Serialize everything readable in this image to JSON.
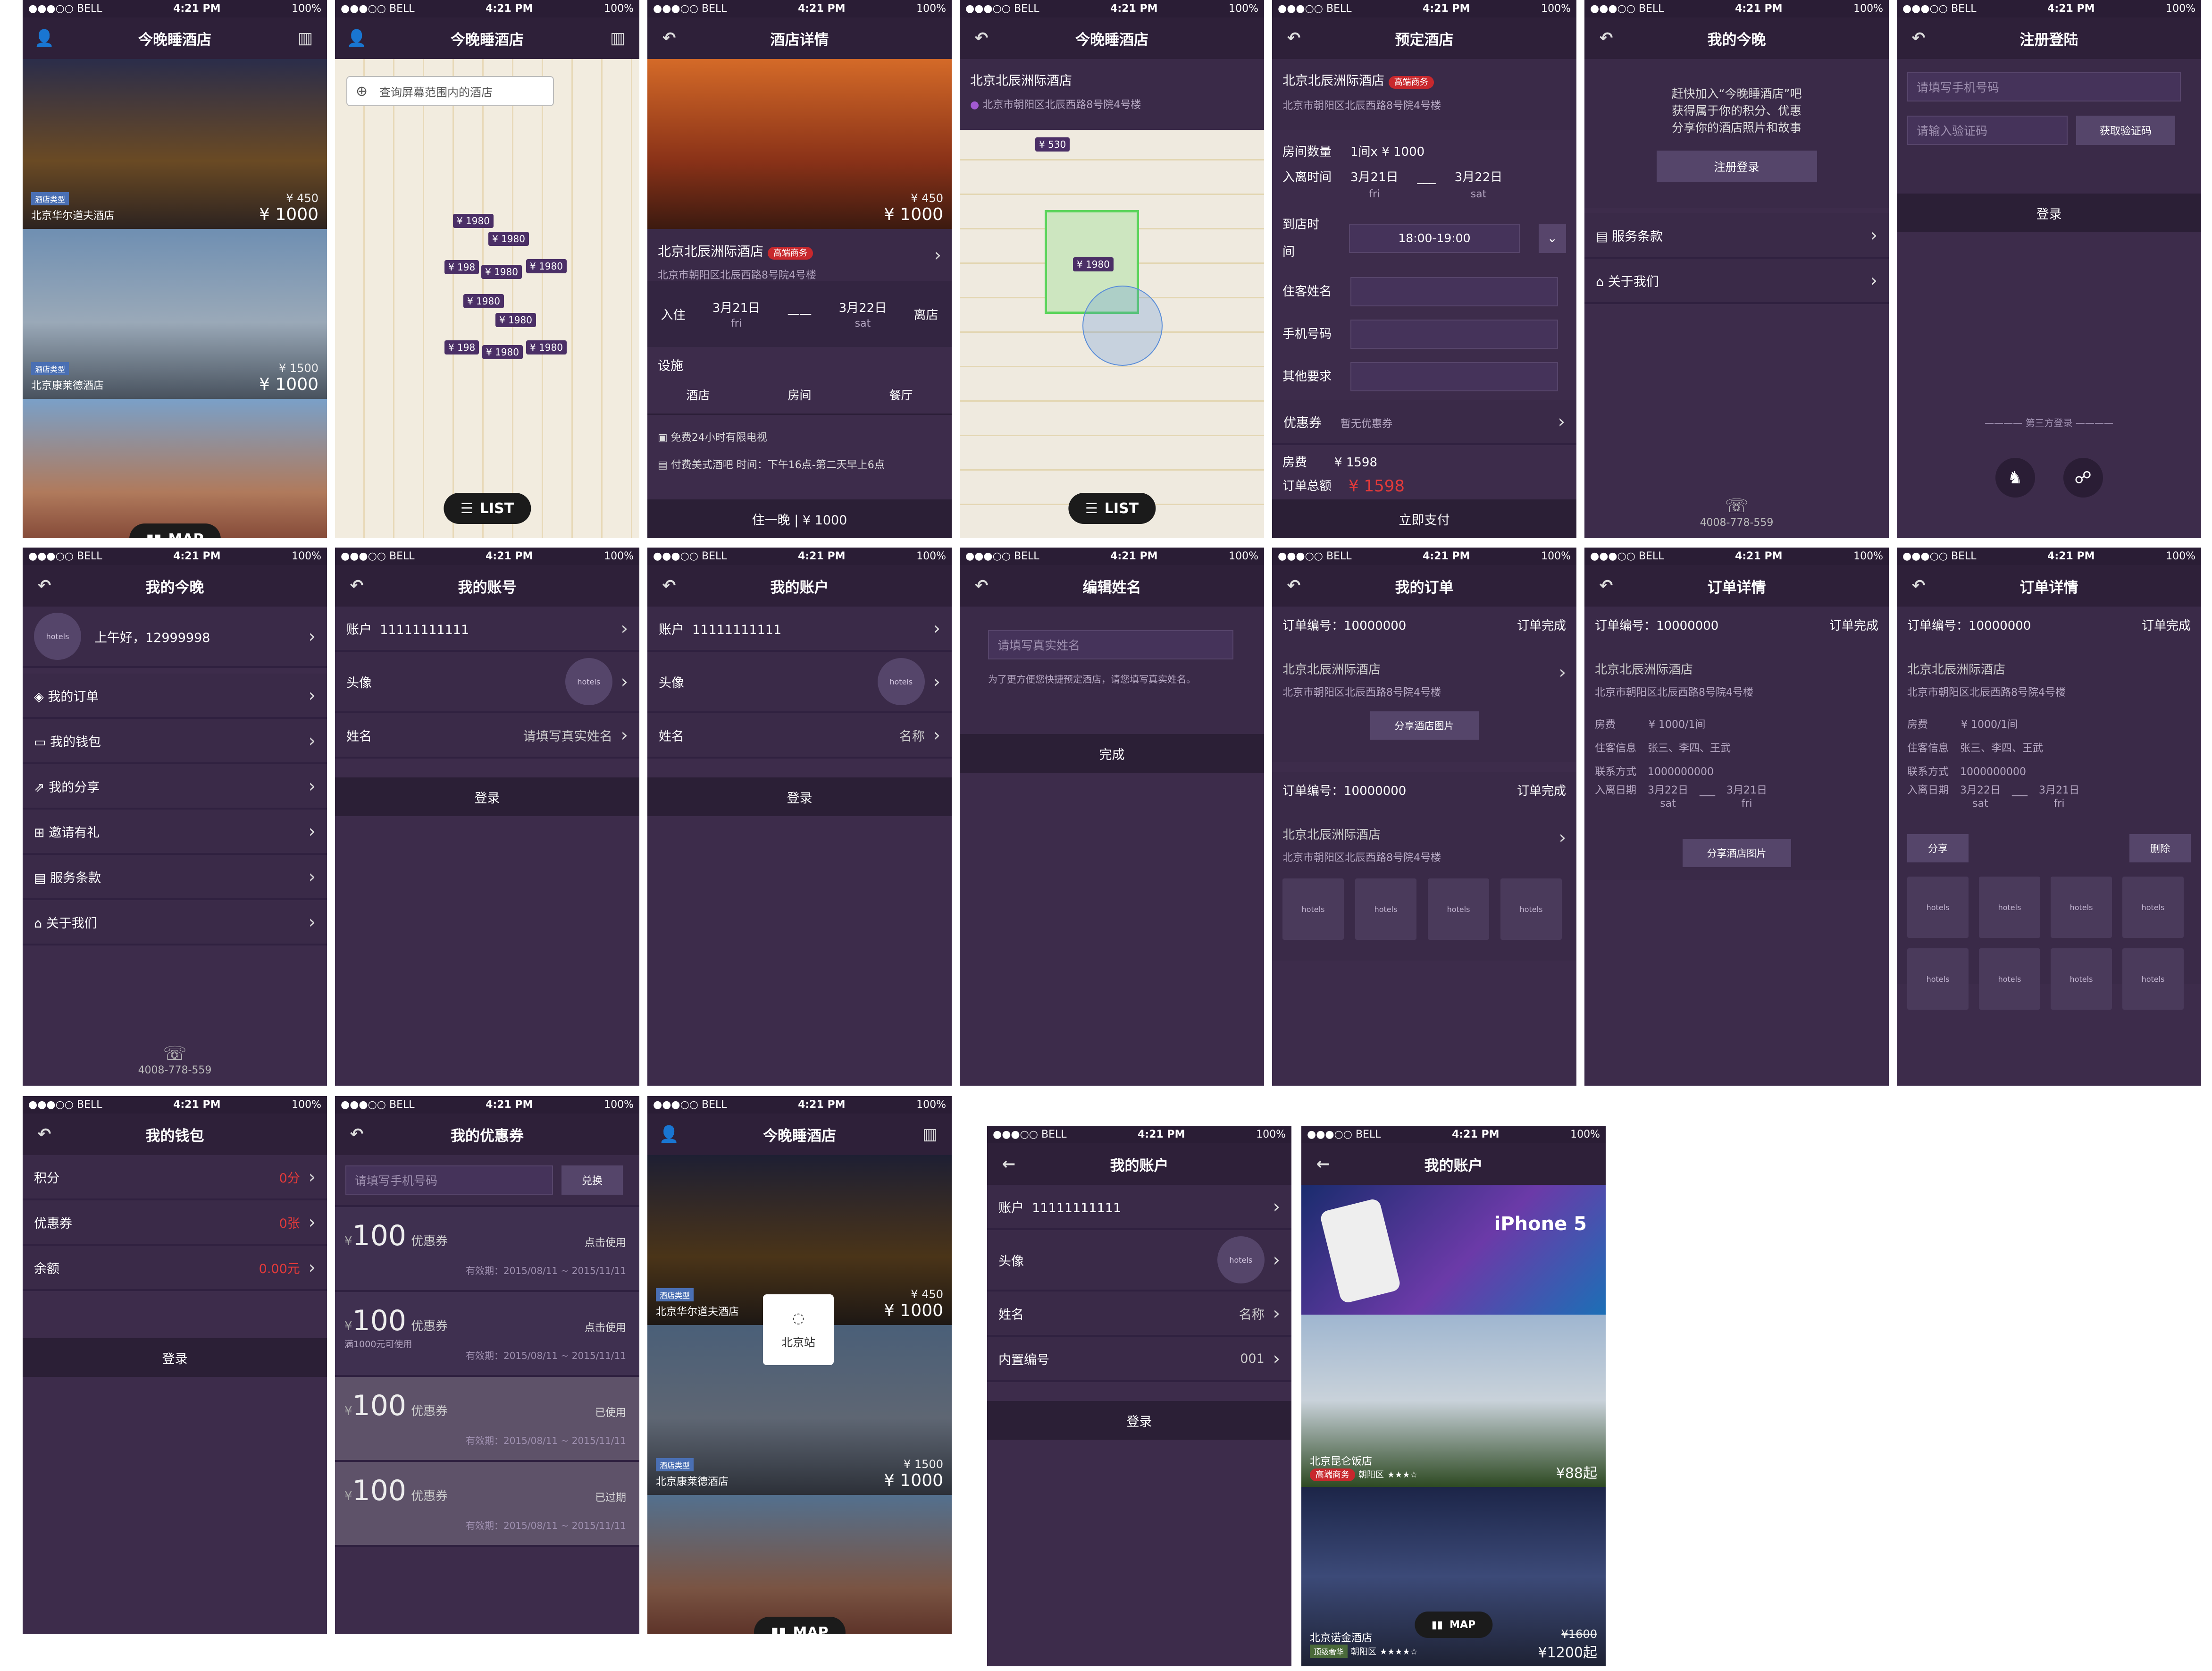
{
  "status": {
    "carrier": "●●●○○ BELL",
    "time": "4:21 PM",
    "battery": "100%"
  },
  "s1": {
    "title": "今晚睡酒店",
    "h1_type": "酒店类型",
    "h1_name": "北京华尔道夫酒店",
    "h1_old": "¥ 450",
    "h1_price": "¥ 1000",
    "h2_type": "酒店类型",
    "h2_name": "北京康莱德酒店",
    "h2_old": "¥ 1500",
    "h2_price": "¥ 1000",
    "map_btn": "MAP"
  },
  "s2": {
    "title": "今晚睡酒店",
    "search": "查询屏幕范围内的酒店",
    "markers": [
      "¥ 1980",
      "¥ 1980",
      "¥ 198",
      "¥ 1980",
      "¥ 1980",
      "¥ 1980",
      "¥ 1980",
      "¥ 198",
      "¥ 1980",
      "¥ 1980"
    ],
    "list_btn": "LIST"
  },
  "s3": {
    "title": "酒店详情",
    "old": "¥ 450",
    "price": "¥ 1000",
    "name": "北京北辰洲际酒店",
    "badge": "高端商务",
    "addr": "北京市朝阳区北辰西路8号院4号楼",
    "checkin": "入住",
    "d1": "3月21日",
    "w1": "fri",
    "d2": "3月22日",
    "w2": "sat",
    "checkout": "离店",
    "fac": "设施",
    "tabs": [
      "酒店",
      "房间",
      "餐厅"
    ],
    "f1": "免费24小时有限电视",
    "f2": "付费美式酒吧 时间：下午16点-第二天早上6点",
    "foot": "住一晚 | ¥ 1000"
  },
  "s4": {
    "title": "今晚睡酒店",
    "name": "北京北辰洲际酒店",
    "addr": "北京市朝阳区北辰西路8号院4号楼",
    "m1": "¥ 530",
    "m2": "¥ 1980",
    "list_btn": "LIST"
  },
  "s5": {
    "title": "预定酒店",
    "name": "北京北辰洲际酒店",
    "badge": "高端商务",
    "addr": "北京市朝阳区北辰西路8号院4号楼",
    "l_room": "房间数量",
    "v_room": "1间x ¥ 1000",
    "l_time": "入离时间",
    "d1": "3月21日",
    "w1": "fri",
    "d2": "3月22日",
    "w2": "sat",
    "l_arr": "到店时间",
    "v_arr": "18:00-19:00",
    "l_name": "住客姓名",
    "l_phone": "手机号码",
    "l_other": "其他要求",
    "l_coupon": "优惠券",
    "v_coupon": "暂无优惠券",
    "l_fee": "房费",
    "v_fee": "¥ 1598",
    "l_total": "订单总额",
    "v_total": "¥ 1598",
    "pay": "立即支付"
  },
  "s6": {
    "title": "我的今晚",
    "intro": "赶快加入“今晚睡酒店”吧\n获得属于你的积分、优惠\n分享你的酒店照片和故事",
    "reg": "注册登录",
    "terms": "服务条款",
    "about": "关于我们",
    "phone": "4008-778-559"
  },
  "s7": {
    "title": "注册登陆",
    "phone_ph": "请填写手机号码",
    "code_ph": "请输入验证码",
    "get_code": "获取验证码",
    "login": "登录",
    "third": "第三方登录"
  },
  "s8": {
    "title": "我的今晚",
    "greet": "上午好，12999998",
    "items": [
      "我的订单",
      "我的钱包",
      "我的分享",
      "邀请有礼",
      "服务条款",
      "关于我们"
    ],
    "phone": "4008-778-559",
    "logo": "hotels"
  },
  "s9": {
    "title": "我的账号",
    "l_acc": "账户",
    "v_acc": "11111111111",
    "l_av": "头像",
    "l_name": "姓名",
    "v_name": "请填写真实姓名",
    "login": "登录",
    "logo": "hotels"
  },
  "s10": {
    "title": "我的账户",
    "l_acc": "账户",
    "v_acc": "11111111111",
    "l_av": "头像",
    "l_name": "姓名",
    "v_name": "名称",
    "login": "登录",
    "logo": "hotels"
  },
  "s11": {
    "title": "编辑姓名",
    "ph": "请填写真实姓名",
    "hint": "为了更方便您快捷预定酒店，请您填写真实姓名。",
    "done": "完成"
  },
  "s12": {
    "title": "我的订单",
    "no": "订单编号：10000000",
    "st": "订单完成",
    "name": "北京北辰洲际酒店",
    "addr": "北京市朝阳区北辰西路8号院4号楼",
    "share": "分享酒店图片",
    "logo": "hotels"
  },
  "s13": {
    "title": "订单详情",
    "no": "订单编号：10000000",
    "st": "订单完成",
    "name": "北京北辰洲际酒店",
    "addr": "北京市朝阳区北辰西路8号院4号楼",
    "l_fee": "房费",
    "v_fee": "¥ 1000/1间",
    "l_guest": "住客信息",
    "v_guest": "张三、李四、王武",
    "l_contact": "联系方式",
    "v_contact": "1000000000",
    "l_date": "入离日期",
    "d1": "3月22日",
    "w1": "sat",
    "d2": "3月21日",
    "w2": "fri",
    "share": "分享酒店图片"
  },
  "s14": {
    "title": "订单详情",
    "no": "订单编号：10000000",
    "st": "订单完成",
    "name": "北京北辰洲际酒店",
    "addr": "北京市朝阳区北辰西路8号院4号楼",
    "l_fee": "房费",
    "v_fee": "¥ 1000/1间",
    "l_guest": "住客信息",
    "v_guest": "张三、李四、王武",
    "l_contact": "联系方式",
    "v_contact": "1000000000",
    "l_date": "入离日期",
    "d1": "3月22日",
    "w1": "sat",
    "d2": "3月21日",
    "w2": "fri",
    "share": "分享",
    "del": "删除",
    "logo": "hotels"
  },
  "s15": {
    "title": "我的钱包",
    "l1": "积分",
    "v1": "0分",
    "l2": "优惠券",
    "v2": "0张",
    "l3": "余额",
    "v3": "0.00元",
    "login": "登录"
  },
  "s16": {
    "title": "我的优惠券",
    "ph": "请填写手机号码",
    "btn": "兑换",
    "label": "优惠券",
    "amt": "100",
    "cur": "¥",
    "c": [
      {
        "act": "点击使用",
        "note": "",
        "date": "有效期：2015/08/11 ~ 2015/11/11"
      },
      {
        "act": "点击使用",
        "note": "满1000元可使用",
        "date": "有效期：2015/08/11 ~ 2015/11/11"
      },
      {
        "act": "已使用",
        "note": "",
        "date": "有效期：2015/08/11 ~ 2015/11/11"
      },
      {
        "act": "已过期",
        "note": "",
        "date": "有效期：2015/08/11 ~ 2015/11/11"
      }
    ]
  },
  "s17": {
    "title": "今晚睡酒店",
    "h1_type": "酒店类型",
    "h1_name": "北京华尔道夫酒店",
    "h1_old": "¥ 450",
    "h1_price": "¥ 1000",
    "h2_type": "酒店类型",
    "h2_name": "北京康莱德酒店",
    "h2_old": "¥ 1500",
    "h2_price": "¥ 1000",
    "loading": "北京站",
    "map_btn": "MAP"
  },
  "s18": {
    "title": "我的账户",
    "l_acc": "账户",
    "v_acc": "11111111111",
    "l_av": "头像",
    "l_name": "姓名",
    "v_name": "名称",
    "l_id": "内置编号",
    "v_id": "001",
    "login": "登录",
    "logo": "hotels"
  },
  "s19": {
    "title": "我的账户",
    "banner": "iPhone 5",
    "h1_name": "北京昆仑饭店",
    "h1_badge": "高端商务",
    "h1_area": "朝阳区",
    "h1_stars": "★★★☆",
    "h1_price": "¥88起",
    "h2_name": "北京诺金酒店",
    "h2_badge": "顶级奢华",
    "h2_area": "朝阳区",
    "h2_stars": "★★★★☆",
    "h2_old": "¥1600",
    "h2_price": "¥1200起",
    "map_btn": "MAP"
  }
}
